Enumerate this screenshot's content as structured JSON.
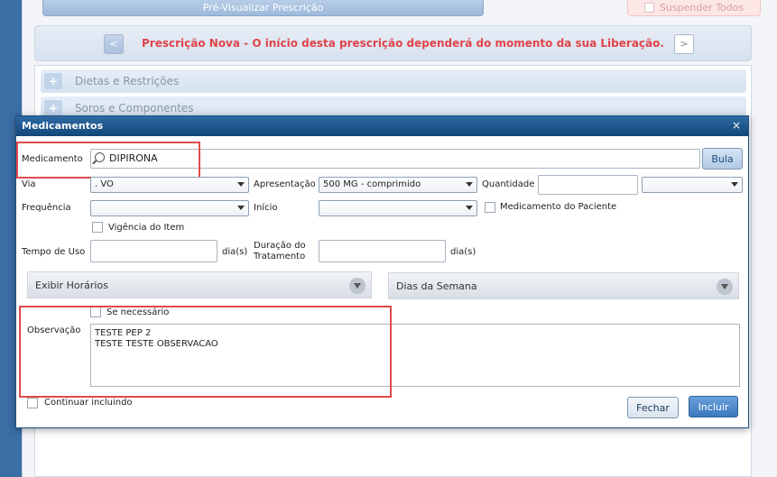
{
  "background": {
    "preview_button": "Pré-Visualizar Prescrição",
    "suspend_all_button": "Suspender Todos",
    "prescription_message": "Prescrição Nova - O início desta prescrição dependerá do momento da sua Liberação.",
    "nav_prev": "<",
    "nav_next": ">",
    "accordion": [
      "Dietas e Restrições",
      "Soros e Componentes"
    ]
  },
  "modal": {
    "title": "Medicamentos",
    "close": "×",
    "medicamento_label": "Medicamento",
    "medicamento_value": "DIPIRONA",
    "bula_button": "Bula",
    "via_label": "Via",
    "via_value": ". VO",
    "apresentacao_label": "Apresentação",
    "apresentacao_value": "500 MG - comprimido",
    "quantidade_label": "Quantidade",
    "quantidade_value": "",
    "quantidade_unit_value": "",
    "frequencia_label": "Frequência",
    "frequencia_value": "",
    "inicio_label": "Início",
    "inicio_value": "",
    "med_paciente_label": "Medicamento do Paciente",
    "vigencia_label": "Vigência do Item",
    "tempo_uso_label": "Tempo de Uso",
    "tempo_uso_value": "",
    "dias_unit_1": "dia(s)",
    "duracao_label_1": "Duração do",
    "duracao_label_2": "Tratamento",
    "duracao_value": "",
    "dias_unit_2": "dia(s)",
    "exibir_horarios": "Exibir Horários",
    "dias_semana": "Dias da Semana",
    "se_necessario_label": "Se necessário",
    "observacao_label": "Observação",
    "observacao_value": "TESTE PEP 2\nTESTE TESTE OBSERVACAO",
    "continuar_label": "Continuar incluindo",
    "fechar_button": "Fechar",
    "incluir_button": "Incluir"
  },
  "colors": {
    "header_blue": "#124779",
    "highlight_red": "#e04b4b",
    "message_red": "#e0444a"
  }
}
